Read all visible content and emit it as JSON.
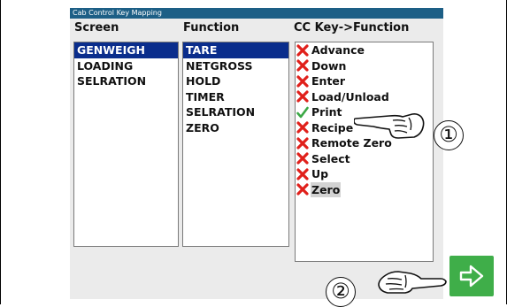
{
  "window": {
    "title": "Cab Control Key Mapping"
  },
  "columns": {
    "screen": {
      "header": "Screen",
      "items": [
        "GENWEIGH",
        "LOADING",
        "SELRATION"
      ],
      "selected": 0
    },
    "function": {
      "header": "Function",
      "items": [
        "TARE",
        "NETGROSS",
        "HOLD",
        "TIMER",
        "SELRATION",
        "ZERO"
      ],
      "selected": 0
    },
    "cc_key": {
      "header": "CC Key->Function",
      "items": [
        {
          "label": "Advance",
          "state": "x"
        },
        {
          "label": "Down",
          "state": "x"
        },
        {
          "label": "Enter",
          "state": "x"
        },
        {
          "label": "Load/Unload",
          "state": "x"
        },
        {
          "label": "Print",
          "state": "check"
        },
        {
          "label": "Recipe",
          "state": "x"
        },
        {
          "label": "Remote Zero",
          "state": "x"
        },
        {
          "label": "Select",
          "state": "x"
        },
        {
          "label": "Up",
          "state": "x"
        },
        {
          "label": "Zero",
          "state": "x"
        }
      ],
      "highlighted": 9
    }
  },
  "callouts": {
    "one": "①",
    "two": "②"
  },
  "icons": {
    "x_mark": "red-x-icon",
    "check_mark": "green-check-icon",
    "next": "arrow-right-icon",
    "pointer": "pointing-hand-icon"
  },
  "colors": {
    "titlebar": "#1d5f86",
    "selection": "#0a2d8c",
    "x_mark": "#e0201b",
    "check_mark": "#3aa845",
    "next_button": "#3fae49"
  }
}
